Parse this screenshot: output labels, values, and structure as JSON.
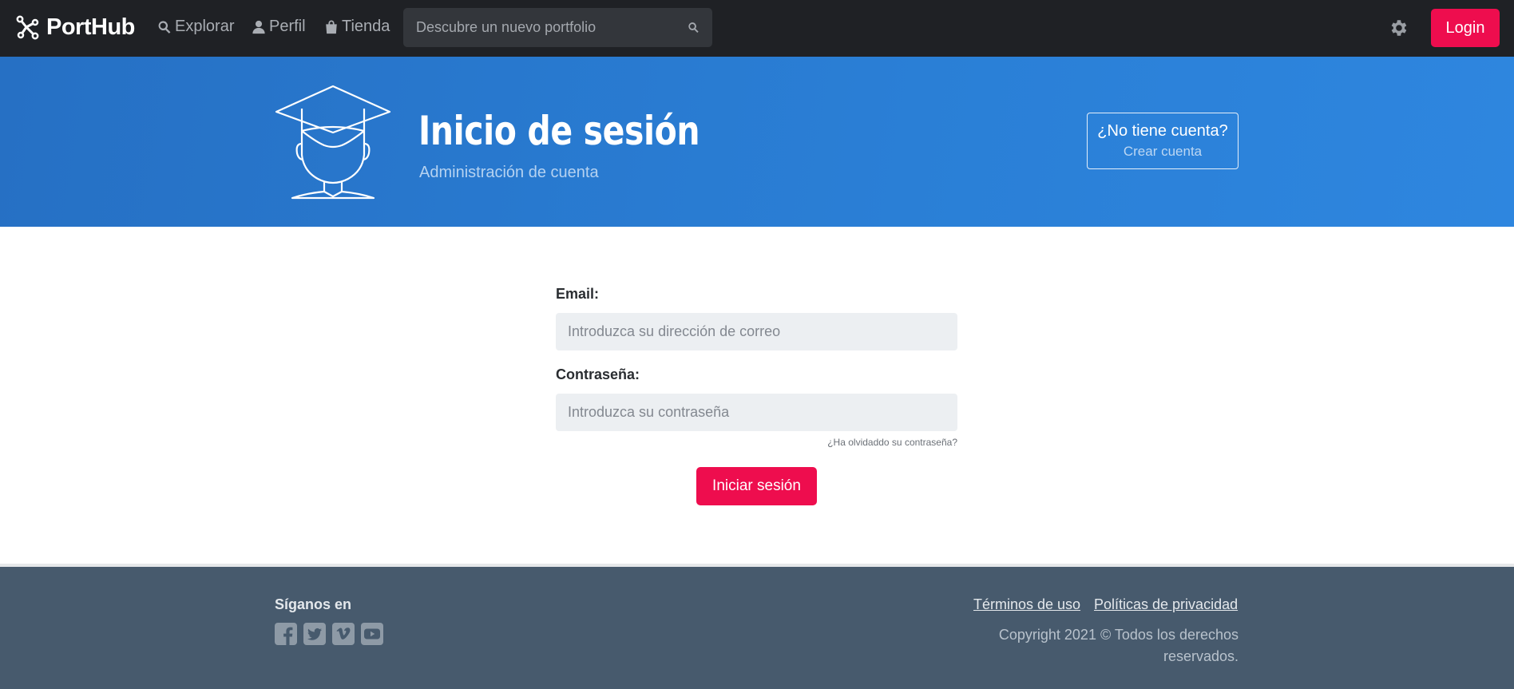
{
  "navbar": {
    "brand": "PortHub",
    "links": [
      {
        "label": "Explorar",
        "icon": "search-icon"
      },
      {
        "label": "Perfil",
        "icon": "user-icon"
      },
      {
        "label": "Tienda",
        "icon": "shopping-bag-icon"
      }
    ],
    "search_placeholder": "Descubre un nuevo portfolio",
    "login_label": "Login"
  },
  "hero": {
    "title": "Inicio de sesión",
    "subtitle": "Administración de cuenta",
    "account_question": "¿No tiene cuenta?",
    "account_create": "Crear cuenta"
  },
  "form": {
    "email_label": "Email:",
    "email_placeholder": "Introduzca su dirección de correo",
    "password_label": "Contraseña:",
    "password_placeholder": "Introduzca su contraseña",
    "forgot_link": "¿Ha olvidaddo su contraseña?",
    "submit_label": "Iniciar sesión"
  },
  "footer": {
    "follow_label": "Síganos en",
    "socials": [
      "facebook-icon",
      "twitter-icon",
      "vimeo-icon",
      "youtube-icon"
    ],
    "terms_link": "Términos de uso",
    "privacy_link": "Políticas de privacidad",
    "copyright": "Copyright 2021 © Todos los derechos reservados."
  },
  "colors": {
    "navbar_bg": "#1f2125",
    "accent": "#ee0d4e",
    "hero_blue": "#2a7fd6",
    "footer_bg": "#475a6d"
  }
}
